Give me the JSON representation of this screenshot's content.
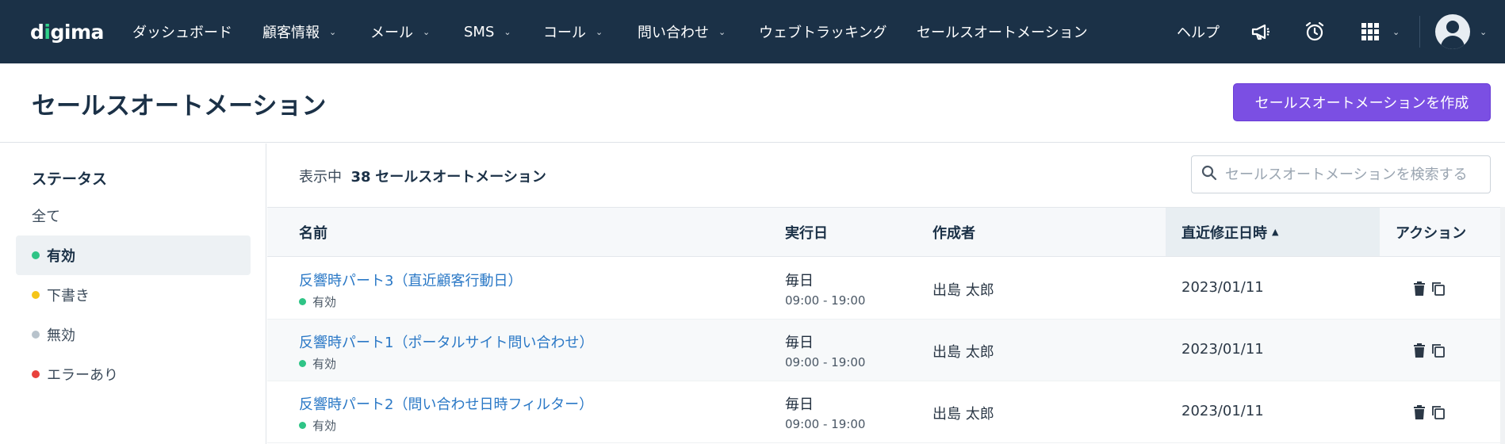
{
  "nav": {
    "logo": {
      "prefix": "d",
      "accent": "i",
      "rest": "gima"
    },
    "items": [
      {
        "label": "ダッシュボード",
        "dropdown": false
      },
      {
        "label": "顧客情報",
        "dropdown": true
      },
      {
        "label": "メール",
        "dropdown": true
      },
      {
        "label": "SMS",
        "dropdown": true
      },
      {
        "label": "コール",
        "dropdown": true
      },
      {
        "label": "問い合わせ",
        "dropdown": true
      },
      {
        "label": "ウェブトラッキング",
        "dropdown": false
      },
      {
        "label": "セールスオートメーション",
        "dropdown": false
      }
    ],
    "help": "ヘルプ",
    "icons": [
      "megaphone-icon",
      "alarm-clock-icon",
      "apps-grid-icon",
      "user-avatar-icon"
    ]
  },
  "page": {
    "title": "セールスオートメーション",
    "create_button": "セールスオートメーションを作成"
  },
  "sidebar": {
    "title": "ステータス",
    "items": [
      {
        "label": "全て",
        "dot": null,
        "active": false
      },
      {
        "label": "有効",
        "dot": "#2fc486",
        "active": true
      },
      {
        "label": "下書き",
        "dot": "#f5c518",
        "active": false
      },
      {
        "label": "無効",
        "dot": "#b8c3cc",
        "active": false
      },
      {
        "label": "エラーあり",
        "dot": "#e8413c",
        "active": false
      }
    ]
  },
  "toolbar": {
    "showing_prefix": "表示中",
    "count": "38",
    "count_suffix": "セールスオートメーション",
    "search_placeholder": "セールスオートメーションを検索する"
  },
  "table": {
    "columns": [
      "名前",
      "実行日",
      "作成者",
      "直近修正日時",
      "アクション"
    ],
    "sorted_column": "直近修正日時",
    "rows": [
      {
        "name": "反響時パート3（直近顧客行動日）",
        "status": "有効",
        "schedule": "毎日",
        "time": "09:00 - 19:00",
        "creator": "出島 太郎",
        "modified": "2023/01/11"
      },
      {
        "name": "反響時パート1（ポータルサイト問い合わせ）",
        "status": "有効",
        "schedule": "毎日",
        "time": "09:00 - 19:00",
        "creator": "出島 太郎",
        "modified": "2023/01/11"
      },
      {
        "name": "反響時パート2（問い合わせ日時フィルター）",
        "status": "有効",
        "schedule": "毎日",
        "time": "09:00 - 19:00",
        "creator": "出島 太郎",
        "modified": "2023/01/11"
      }
    ]
  },
  "colors": {
    "nav_bg": "#1b3147",
    "primary_button": "#7b4fe3",
    "link": "#2a78c6",
    "active_status": "#2fc486"
  }
}
